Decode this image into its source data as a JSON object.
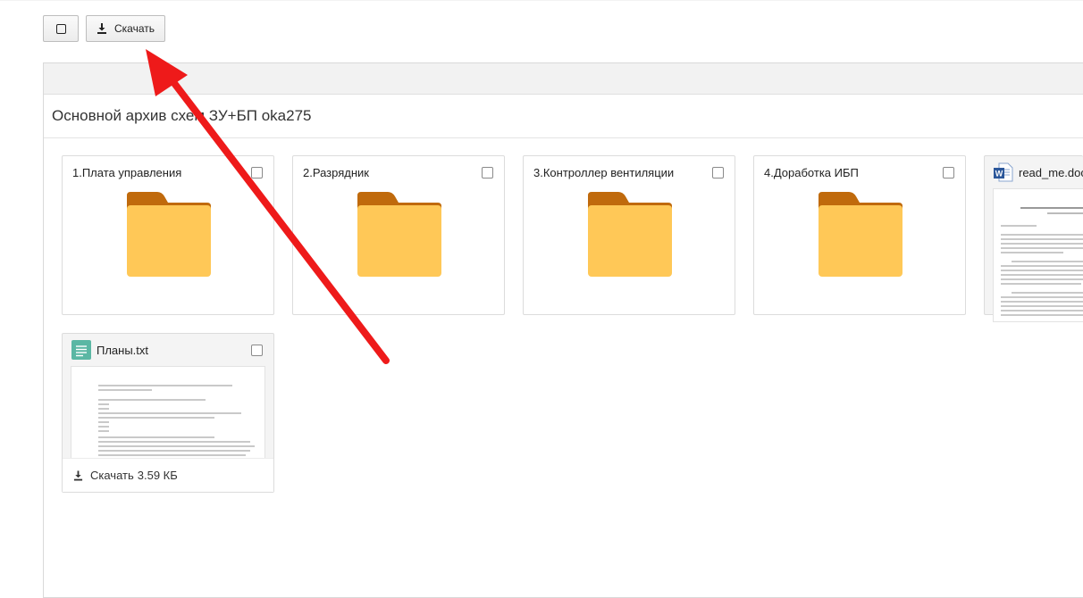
{
  "toolbar": {
    "select_icon": "square-outline-icon",
    "download_icon": "download-icon",
    "download_label": "Скачать"
  },
  "panel": {
    "title": "Основной архив схем ЗУ+БП oka275"
  },
  "folders": [
    {
      "name": "1.Плата управления",
      "icon": "folder-icon"
    },
    {
      "name": "2.Разрядник",
      "icon": "folder-icon"
    },
    {
      "name": "3.Контроллер вентиляции",
      "icon": "folder-icon"
    },
    {
      "name": "4.Доработка ИБП",
      "icon": "folder-icon"
    }
  ],
  "files": [
    {
      "name": "read_me.doc",
      "icon": "word-doc-icon"
    },
    {
      "name": "Планы.txt",
      "icon": "text-file-icon",
      "download_label": "Скачать",
      "size": "3.59 КБ"
    }
  ],
  "colors": {
    "folder_front": "#ffc857",
    "folder_back": "#c06a0c",
    "annotation_arrow": "#ee1a1a",
    "txt_icon": "#5bb7a4",
    "doc_icon": "#2b579a"
  }
}
